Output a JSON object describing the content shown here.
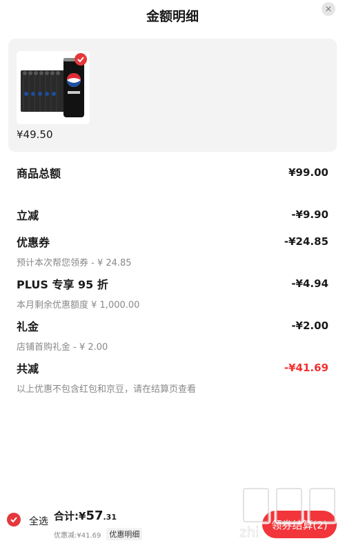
{
  "header": {
    "title": "金额明细",
    "close_icon": "×"
  },
  "product": {
    "price": "¥49.50",
    "image_label": "百事可乐"
  },
  "rows": [
    {
      "label": "商品总额",
      "value": "¥99.00",
      "sub": ""
    },
    {
      "label": "立减",
      "value": "-¥9.90",
      "sub": ""
    },
    {
      "label": "优惠券",
      "value": "-¥24.85",
      "sub": "预计本次帮您领券 - ¥ 24.85"
    },
    {
      "label": "PLUS 专享 95 折",
      "value": "-¥4.94",
      "sub": "本月剩余优惠额度 ¥ 1,000.00"
    },
    {
      "label": "礼金",
      "value": "-¥2.00",
      "sub": "店铺首购礼金 - ¥ 2.00"
    },
    {
      "label": "共减",
      "value": "-¥41.69",
      "sub": "以上优惠不包含红包和京豆，请在结算页查看"
    }
  ],
  "bottom": {
    "select_all": "全选",
    "total_prefix": "合计:¥",
    "total_int": "57",
    "total_dec": ".31",
    "discount": "优惠减:¥41.69",
    "detail_tag": "优惠明细",
    "checkout": "领券结算(2)"
  },
  "watermark": {
    "text": "值值值",
    "domain": "zhi"
  },
  "colors": {
    "accent": "#f23030",
    "card_bg": "#f3f3f3"
  }
}
